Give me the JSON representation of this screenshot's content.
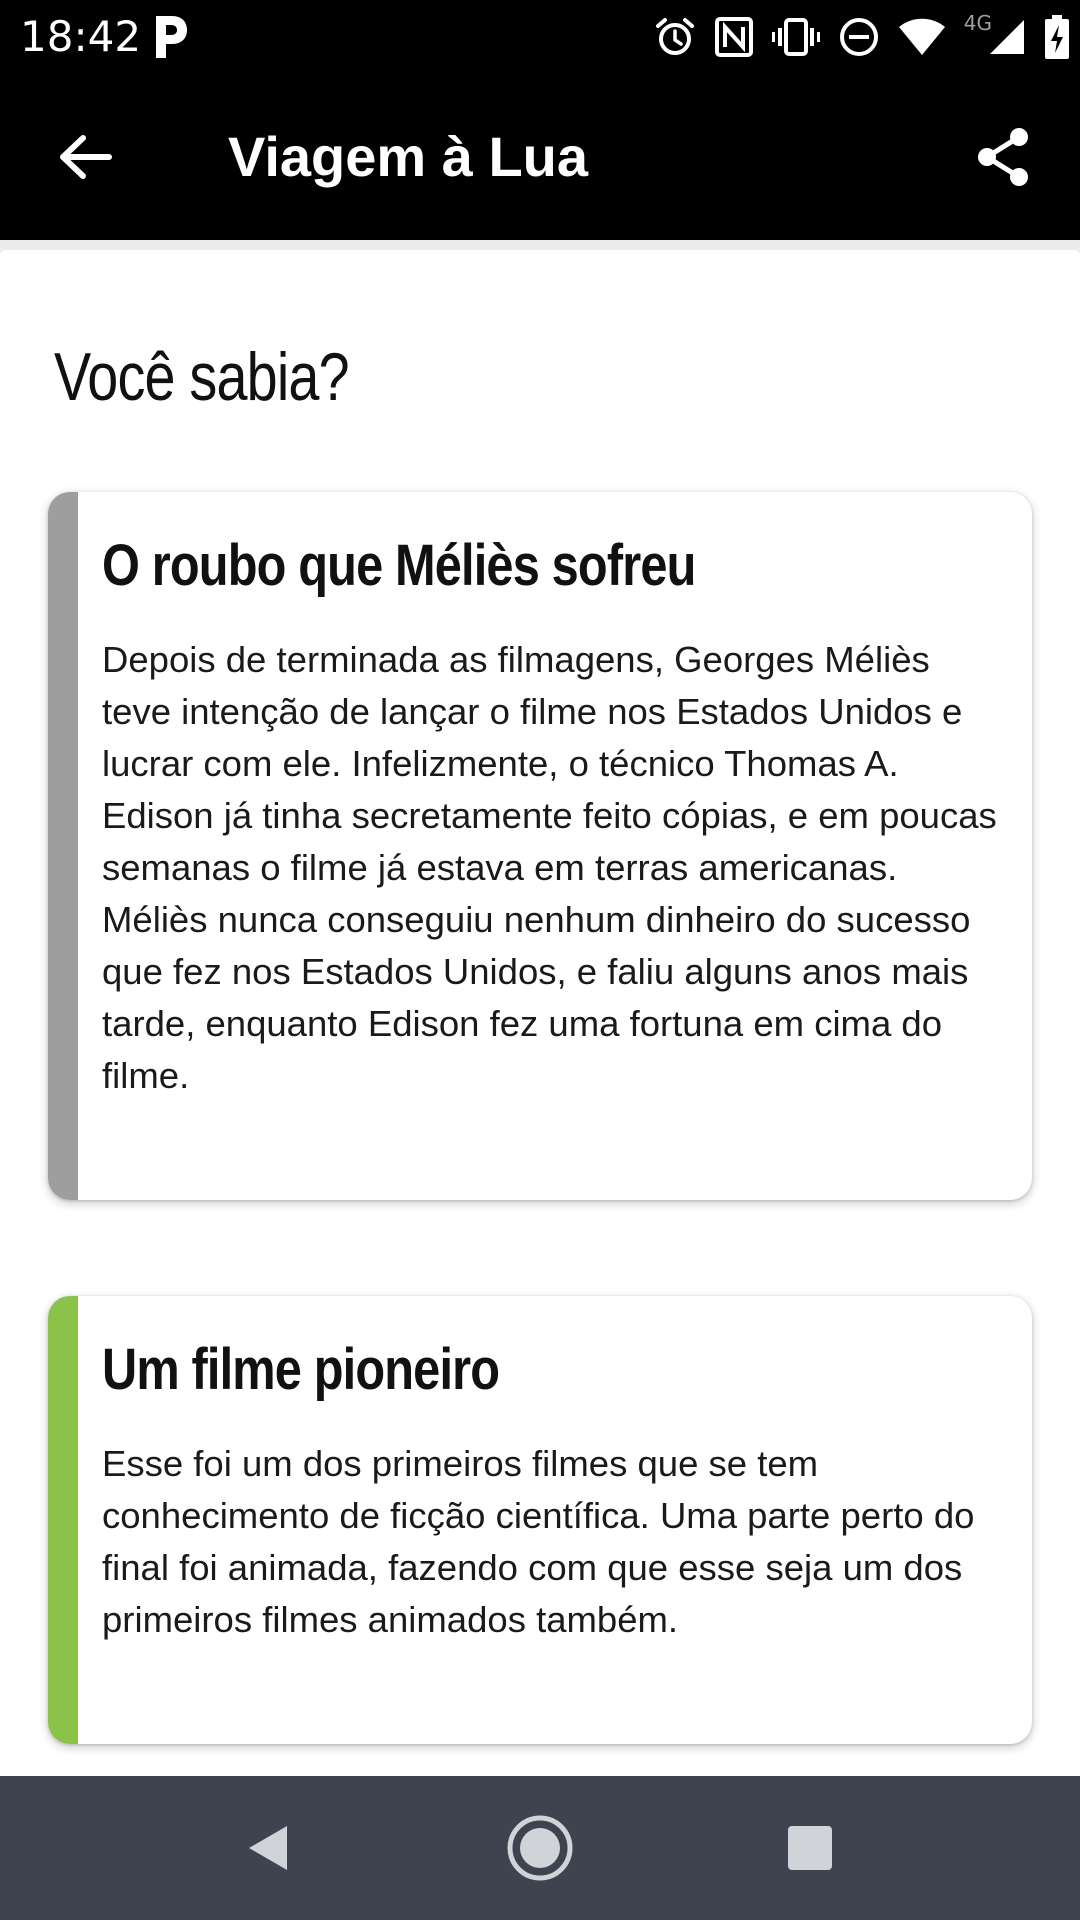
{
  "status_bar": {
    "time": "18:42",
    "network_label": "4G",
    "icons": [
      "p-icon",
      "alarm-icon",
      "nfc-icon",
      "vibrate-icon",
      "do-not-disturb-icon",
      "wifi-icon",
      "signal-icon",
      "battery-charging-icon"
    ]
  },
  "app_bar": {
    "title": "Viagem à Lua",
    "back_icon": "arrow-left-icon",
    "share_icon": "share-icon"
  },
  "main": {
    "section_title": "Você sabia?",
    "cards": [
      {
        "title": "O roubo que Méliès sofreu",
        "body": "Depois de terminada as filmagens, Georges Méliès teve intenção de lançar o filme nos Estados Unidos e lucrar com ele. Infelizmente, o técnico Thomas A. Edison já tinha secretamente feito cópias, e em poucas semanas o filme já estava em terras americanas. Méliès nunca conseguiu nenhum dinheiro do sucesso que fez nos Estados Unidos, e faliu alguns anos mais tarde, enquanto Edison fez uma fortuna em cima do filme.",
        "accent_color": "#9e9e9e"
      },
      {
        "title": "Um filme pioneiro",
        "body": "Esse foi um dos primeiros filmes que se tem conhecimento de ficção científica. Uma parte perto do final foi animada, fazendo com que esse seja um dos primeiros filmes animados também.",
        "accent_color": "#8bc34a"
      }
    ]
  },
  "nav_bar": {
    "buttons": [
      "back-triangle-icon",
      "home-circle-icon",
      "recents-square-icon"
    ],
    "background": "#3d4450"
  }
}
